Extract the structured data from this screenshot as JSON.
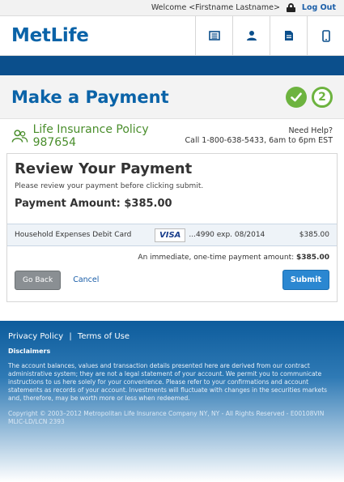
{
  "topbar": {
    "welcome": "Welcome <Firstname Lastname>",
    "logout": "Log Out"
  },
  "header": {
    "logo": "MetLife",
    "icons": [
      "statement-icon",
      "person-icon",
      "document-icon",
      "mobile-icon"
    ]
  },
  "page": {
    "title": "Make a Payment",
    "step_done": "✓",
    "step_current": "2"
  },
  "policy": {
    "name": "Life Insurance Policy 987654",
    "help_title": "Need Help?",
    "help_text": "Call 1-800-638-5433, 6am to 6pm EST"
  },
  "review": {
    "title": "Review Your Payment",
    "subtitle": "Please review your payment before clicking submit.",
    "amount_label": "Payment Amount: $385.00"
  },
  "payment_row": {
    "account": "Household Expenses Debit Card",
    "card_brand": "VISA",
    "digits": "...4990  exp. 08/2014",
    "amount": "$385.00"
  },
  "confirm": {
    "prefix": "An immediate, one-time payment amount: ",
    "amount": "$385.00"
  },
  "buttons": {
    "back": "Go Back",
    "cancel": "Cancel",
    "submit": "Submit"
  },
  "footer": {
    "privacy": "Privacy Policy",
    "separator": "|",
    "terms": "Terms of Use",
    "disclaimers": "Disclaimers",
    "body": "The account balances, values and transaction details presented here are derived from our contract administrative system; they are not a legal statement of your account. We permit you to communicate instructions to us here solely for your convenience. Please refer to your confirmations and account statements as records of your account. Investments will fluctuate with changes in the securities markets and, therefore, may be worth more or less when redeemed.",
    "copyright": "Copyright © 2003–2012 Metropolitan Life Insurance Company NY, NY - All Rights Reserved - E00108VIN MLIC-LD/LCN 2393"
  },
  "colors": {
    "brand_blue": "#0a63a8",
    "nav_blue": "#0b4f8c",
    "green": "#6db33f",
    "submit_blue": "#2b87d1"
  }
}
